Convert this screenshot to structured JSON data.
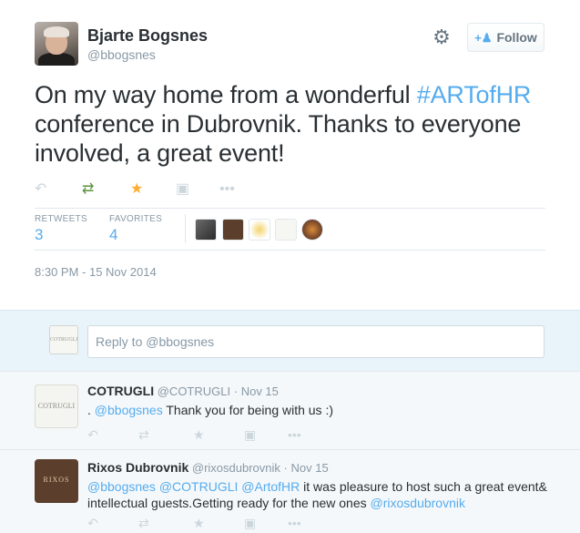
{
  "author": {
    "name": "Bjarte Bogsnes",
    "handle": "@bbogsnes"
  },
  "follow_label": "Follow",
  "tweet": {
    "text_before": "On my way home from a wonderful ",
    "hashtag": "#ARTofHR",
    "text_after": " conference in Dubrovnik. Thanks to everyone involved, a great event!"
  },
  "stats": {
    "retweets_label": "RETWEETS",
    "retweets": "3",
    "favorites_label": "FAVORITES",
    "favorites": "4"
  },
  "timestamp": "8:30 PM - 15 Nov 2014",
  "reply_box": {
    "placeholder": "Reply to @bbogsnes",
    "avatar_text": "COTRUGLI"
  },
  "replies": [
    {
      "name": "COTRUGLI",
      "handle": "@COTRUGLI",
      "dot": "·",
      "time": "Nov 15",
      "avatar_text": "COTRUGLI",
      "prefix": ". ",
      "mention": "@bbogsnes",
      "text": " Thank you for being with us :)"
    },
    {
      "name": "Rixos Dubrovnik",
      "handle": "@rixosdubrovnik",
      "dot": "·",
      "time": "Nov 15",
      "avatar_text": "RIXOS",
      "mention1": "@bbogsnes",
      "mention2": "@COTRUGLI",
      "mention3": "@ArtofHR",
      "text": "  it was pleasure to host such a great event& intellectual guests.Getting ready for the new ones ",
      "mention4": "@rixosdubrovnik"
    }
  ],
  "icons": {
    "reply": "reply-icon",
    "retweet": "retweet-icon",
    "favorite": "star-icon",
    "pocket": "pocket-icon",
    "more": "more-icon",
    "gear": "gear-icon",
    "follow": "add-user-icon"
  },
  "colors": {
    "link": "#55acee",
    "retweet_active": "#5c913b",
    "favorite_active": "#ffac33",
    "muted": "#8899a6",
    "reply_bg": "#e8f3fa",
    "replies_bg": "#f5f8fa"
  }
}
